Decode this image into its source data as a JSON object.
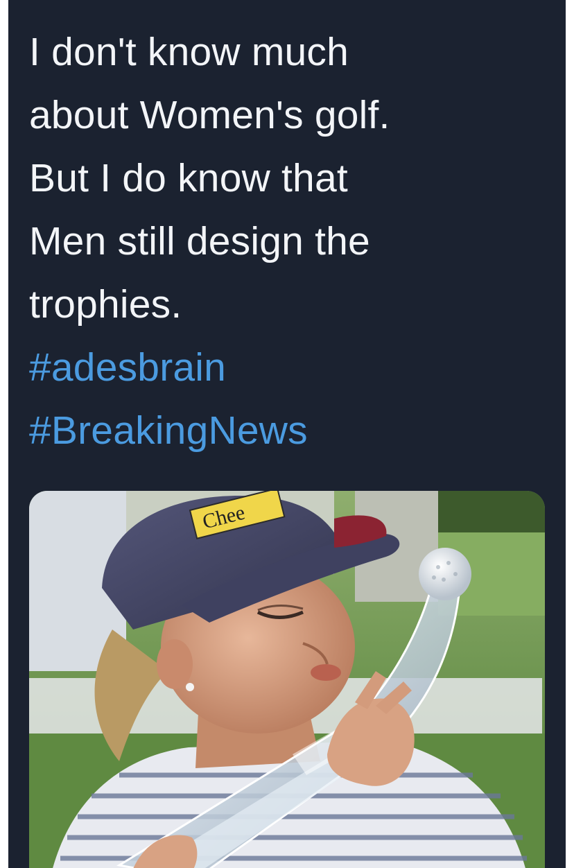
{
  "tweet": {
    "text_lines": [
      "I don't know much",
      "about Women's golf.",
      "But I do know that",
      "Men still design the",
      "trophies."
    ],
    "hashtags": [
      "#adesbrain",
      "#BreakingNews"
    ]
  },
  "media": {
    "cap_logo_text": "Chee"
  },
  "colors": {
    "background": "#1b2230",
    "text": "#f3f5f8",
    "hashtag": "#4b9be0"
  }
}
